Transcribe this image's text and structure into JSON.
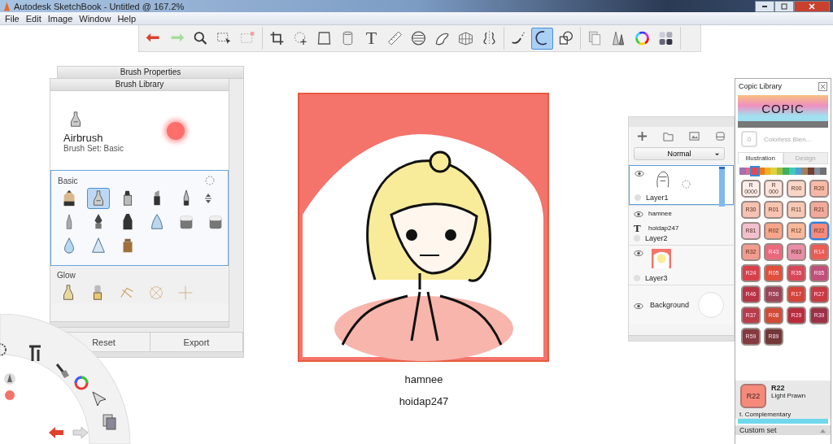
{
  "window": {
    "title": "Autodesk SketchBook - Untitled @ 167.2%"
  },
  "menu": [
    "File",
    "Edit",
    "Image",
    "Window",
    "Help"
  ],
  "toolbar": {
    "groups": [
      [
        {
          "kind": "undo",
          "selected": false
        },
        {
          "kind": "redo",
          "selected": false
        },
        {
          "kind": "zoom",
          "selected": false
        },
        {
          "kind": "select",
          "selected": false
        },
        {
          "kind": "select-clear",
          "selected": false
        }
      ],
      [
        {
          "kind": "crop",
          "selected": false
        },
        {
          "kind": "transform",
          "selected": false
        },
        {
          "kind": "perspective",
          "selected": false
        },
        {
          "kind": "fill",
          "selected": false
        },
        {
          "kind": "text",
          "label": "T",
          "selected": false
        },
        {
          "kind": "ruler",
          "selected": false
        },
        {
          "kind": "ellipse",
          "selected": false
        },
        {
          "kind": "french-curve",
          "selected": false
        },
        {
          "kind": "perspective-grid",
          "selected": false
        },
        {
          "kind": "symmetry",
          "selected": false
        }
      ],
      [
        {
          "kind": "stroke",
          "selected": false
        },
        {
          "kind": "predictive",
          "selected": true
        },
        {
          "kind": "shape",
          "selected": false
        }
      ],
      [
        {
          "kind": "copy",
          "selected": false
        },
        {
          "kind": "brushes",
          "selected": false
        },
        {
          "kind": "color-wheel",
          "selected": false
        },
        {
          "kind": "copic",
          "selected": false
        }
      ]
    ]
  },
  "brush_properties": {
    "title": "Brush Properties",
    "buttons": [
      "Reset",
      "Export"
    ]
  },
  "brush_library": {
    "title": "Brush Library",
    "current": {
      "name": "Airbrush",
      "set": "Brush Set: Basic"
    },
    "groups": [
      {
        "name": "Basic",
        "brushes": [
          {
            "kind": "pencil",
            "selected": false
          },
          {
            "kind": "airbrush",
            "selected": true
          },
          {
            "kind": "marker",
            "selected": false
          },
          {
            "kind": "chisel",
            "selected": false
          },
          {
            "kind": "pen",
            "selected": false
          },
          {
            "kind": "felt",
            "selected": false
          },
          {
            "kind": "ink",
            "selected": false
          },
          {
            "kind": "fineliner",
            "selected": false
          },
          {
            "kind": "soft-cone",
            "selected": false
          },
          {
            "kind": "eraser",
            "selected": false
          },
          {
            "kind": "eraser",
            "selected": false
          },
          {
            "kind": "drop",
            "selected": false
          },
          {
            "kind": "cone",
            "selected": false
          },
          {
            "kind": "wood",
            "selected": false
          }
        ]
      },
      {
        "name": "Glow",
        "brushes": [
          {
            "kind": "glow-airbrush",
            "selected": false
          },
          {
            "kind": "glow-brush",
            "selected": false
          },
          {
            "kind": "sparkle",
            "selected": false
          },
          {
            "kind": "swirl",
            "selected": false
          },
          {
            "kind": "cross",
            "selected": false
          }
        ]
      }
    ]
  },
  "canvas": {
    "captions": [
      "hamnee",
      "hoidap247"
    ]
  },
  "layers": {
    "blend_mode": "Normal",
    "items": [
      {
        "name": "Layer1",
        "kind": "sketch",
        "selected": true
      },
      {
        "name": "Layer2",
        "kind": "text",
        "selected": false,
        "texts": [
          "hamnee",
          "hoidap247"
        ],
        "glyph": "T"
      },
      {
        "name": "Layer3",
        "kind": "image",
        "selected": false
      },
      {
        "name": "Background",
        "kind": "background",
        "selected": false
      }
    ]
  },
  "copic": {
    "title": "Copic Library",
    "logo": "COPIC",
    "blender": {
      "code": "0",
      "name": "Colorless Blen..."
    },
    "tabs": [
      {
        "label": "Illustration",
        "selected": true
      },
      {
        "label": "Design",
        "selected": false
      }
    ],
    "hues": [
      {
        "color": "#a070b0",
        "selected": false
      },
      {
        "color": "#e06a8a",
        "selected": false
      },
      {
        "color": "#e04a5a",
        "selected": true
      },
      {
        "color": "#f07a20",
        "selected": false
      },
      {
        "color": "#f0b020",
        "selected": false
      },
      {
        "color": "#e0d040",
        "selected": false
      },
      {
        "color": "#a0c040",
        "selected": false
      },
      {
        "color": "#40b060",
        "selected": false
      },
      {
        "color": "#40c8c0",
        "selected": false
      },
      {
        "color": "#50a0d0",
        "selected": false
      },
      {
        "color": "#a08060",
        "selected": false
      },
      {
        "color": "#704030",
        "selected": false
      },
      {
        "color": "#8090a0",
        "selected": false
      },
      {
        "color": "#707070",
        "selected": false
      }
    ],
    "swatches": [
      {
        "label": "R\n0000",
        "color": "#fbeeea",
        "selected": false
      },
      {
        "label": "R\n000",
        "color": "#f9e3dc",
        "selected": false
      },
      {
        "label": "R00",
        "color": "#f9d6c8",
        "selected": false
      },
      {
        "label": "R20",
        "color": "#f8b9a6",
        "selected": false
      },
      {
        "label": "R30",
        "color": "#f6c2b3",
        "selected": false
      },
      {
        "label": "R01",
        "color": "#f8c4b0",
        "selected": false
      },
      {
        "label": "R11",
        "color": "#f6c8b6",
        "selected": false
      },
      {
        "label": "R21",
        "color": "#f2a99b",
        "selected": false
      },
      {
        "label": "R81",
        "color": "#f1c0cc",
        "selected": false
      },
      {
        "label": "R02",
        "color": "#f6a58a",
        "selected": false
      },
      {
        "label": "R12",
        "color": "#f8b89b",
        "selected": false
      },
      {
        "label": "R22",
        "color": "#f58a7b",
        "selected": true
      },
      {
        "label": "R32",
        "color": "#f29b8f",
        "selected": false
      },
      {
        "label": "R43",
        "color": "#ea6a7c",
        "selected": false
      },
      {
        "label": "R83",
        "color": "#e88ea6",
        "selected": false
      },
      {
        "label": "R14",
        "color": "#ea5d54",
        "selected": false
      },
      {
        "label": "R24",
        "color": "#d8404a",
        "selected": false
      },
      {
        "label": "R05",
        "color": "#e0503c",
        "selected": false
      },
      {
        "label": "R35",
        "color": "#d84858",
        "selected": false
      },
      {
        "label": "R85",
        "color": "#c0507a",
        "selected": false
      },
      {
        "label": "R46",
        "color": "#b83444",
        "selected": false
      },
      {
        "label": "R56",
        "color": "#9c4458",
        "selected": false
      },
      {
        "label": "R17",
        "color": "#d44438",
        "selected": false
      },
      {
        "label": "R27",
        "color": "#c83a44",
        "selected": false
      },
      {
        "label": "R37",
        "color": "#b83c4a",
        "selected": false
      },
      {
        "label": "R08",
        "color": "#d04c36",
        "selected": false
      },
      {
        "label": "R29",
        "color": "#b82c3c",
        "selected": false
      },
      {
        "label": "R39",
        "color": "#9c3046",
        "selected": false
      },
      {
        "label": "R59",
        "color": "#843a3e",
        "selected": false
      },
      {
        "label": "R89",
        "color": "#723838",
        "selected": false
      }
    ],
    "current": {
      "code": "R22",
      "swatch": "R22",
      "name": "Light Prawn",
      "color": "#f58a7b"
    },
    "complementary": "t. Complementary",
    "custom_set": "Custom set"
  }
}
